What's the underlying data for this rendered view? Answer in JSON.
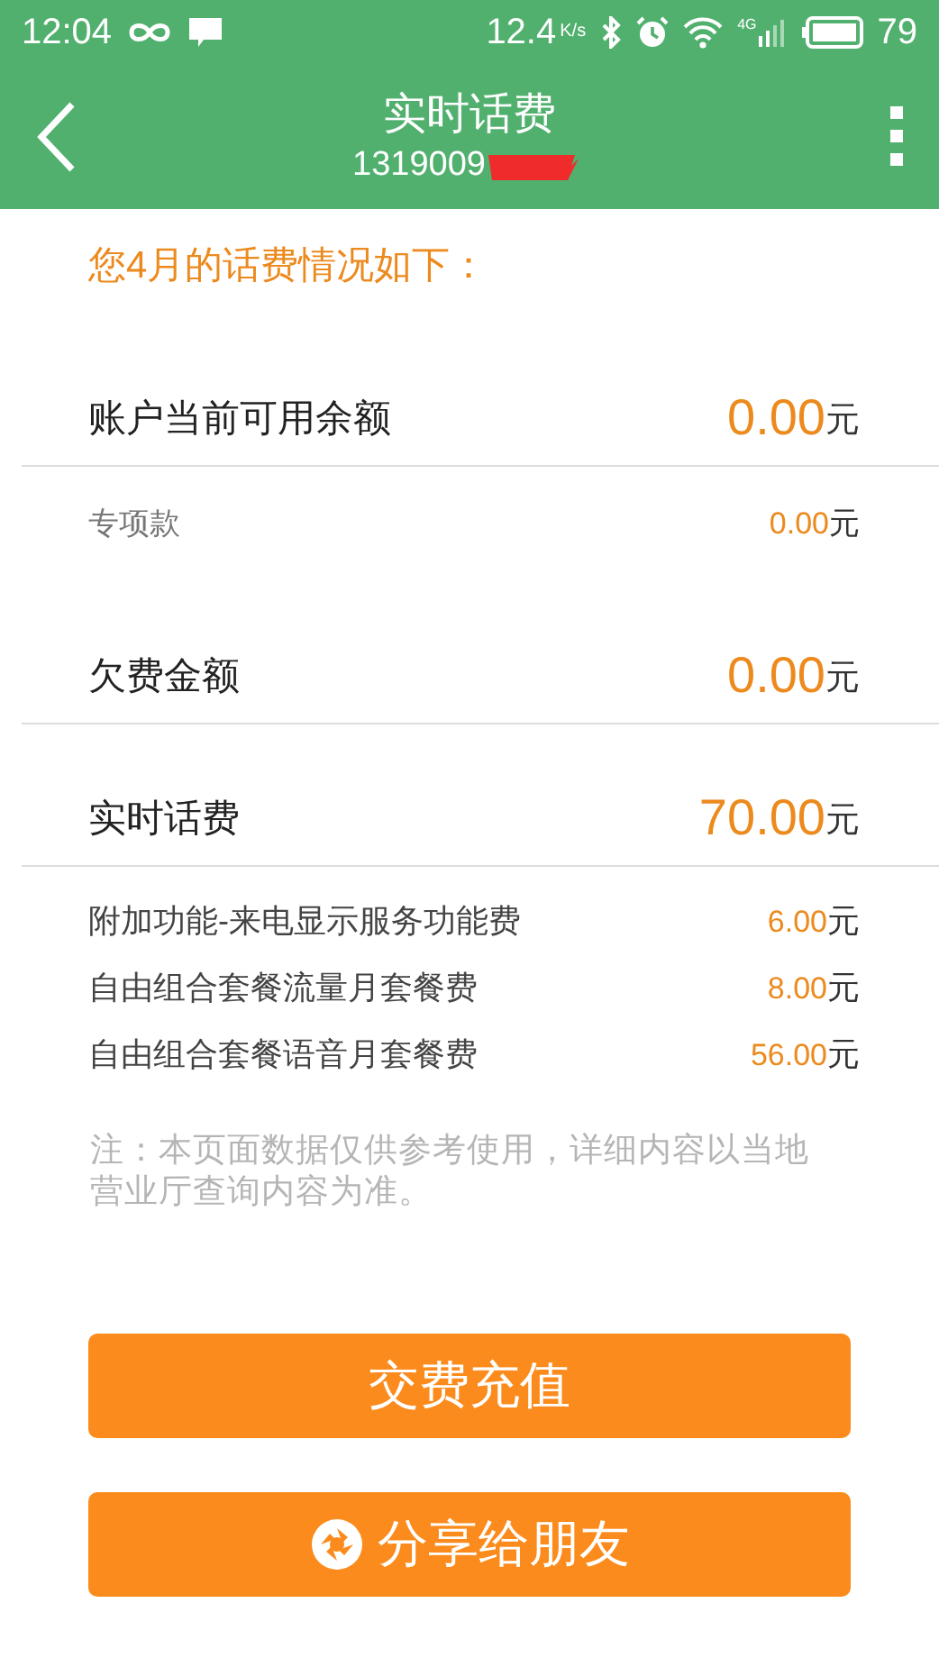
{
  "status_bar": {
    "time": "12:04",
    "speed": "12.4",
    "speed_unit": "K/s",
    "network": "4G",
    "battery": "79"
  },
  "header": {
    "title": "实时话费",
    "phone": "1319009"
  },
  "heading": "您4月的话费情况如下：",
  "rows": [
    {
      "kind": "main",
      "label": "账户当前可用余额",
      "amount": "0.00",
      "unit": "元"
    },
    {
      "kind": "sub",
      "label": "专项款",
      "amount": "0.00",
      "unit": "元"
    },
    {
      "kind": "main",
      "label": "欠费金额",
      "amount": "0.00",
      "unit": "元"
    },
    {
      "kind": "main",
      "label": "实时话费",
      "amount": "70.00",
      "unit": "元"
    },
    {
      "kind": "detail",
      "label": "附加功能-来电显示服务功能费",
      "amount": "6.00",
      "unit": "元"
    },
    {
      "kind": "detail",
      "label": "自由组合套餐流量月套餐费",
      "amount": "8.00",
      "unit": "元"
    },
    {
      "kind": "detail",
      "label": "自由组合套餐语音月套餐费",
      "amount": "56.00",
      "unit": "元"
    }
  ],
  "note": "注：本页面数据仅供参考使用，详细内容以当地营业厅查询内容为准。",
  "buttons": [
    {
      "label": "交费充值",
      "icon": false
    },
    {
      "label": "分享给朋友",
      "icon": true
    }
  ]
}
